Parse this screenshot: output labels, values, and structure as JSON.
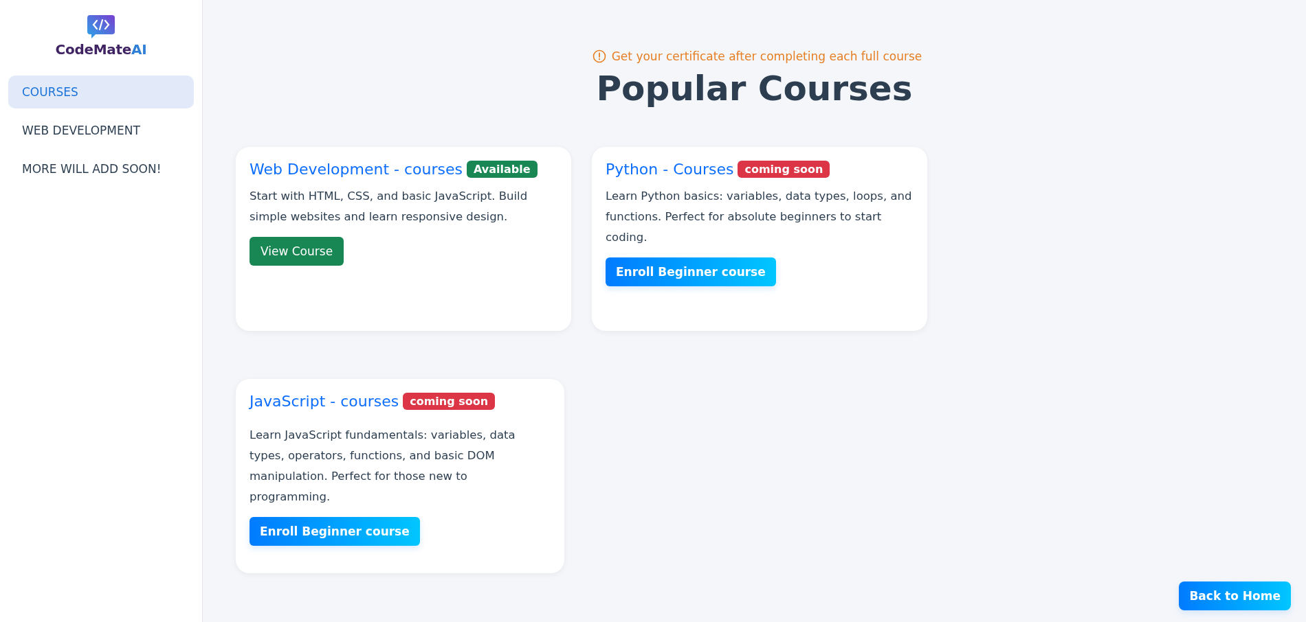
{
  "brand": {
    "name": "CodeMate",
    "accent": "AI"
  },
  "sidebar": {
    "items": [
      {
        "label": "COURSES",
        "selected": true
      },
      {
        "label": "WEB DEVELOPMENT",
        "selected": false
      },
      {
        "label": "MORE WILL ADD SOON!",
        "selected": false
      }
    ]
  },
  "notice": "Get your certificate after completing each full course",
  "title": "Popular Courses",
  "courses": [
    {
      "title": "Web Development - courses",
      "badge": {
        "text": "Available",
        "kind": "available"
      },
      "description": "Start with HTML, CSS, and basic JavaScript. Build simple websites and learn responsive design.",
      "button": {
        "label": "View Course",
        "kind": "view"
      }
    },
    {
      "title": "Python - Courses",
      "badge": {
        "text": "coming soon",
        "kind": "soon"
      },
      "description": "Learn Python basics: variables, data types, loops, and functions. Perfect for absolute beginners to start coding.",
      "button": {
        "label": "Enroll Beginner course",
        "kind": "enroll"
      }
    },
    {
      "title": "JavaScript - courses",
      "badge": {
        "text": "coming soon",
        "kind": "soon"
      },
      "description": "Learn JavaScript fundamentals: variables, data types, operators, functions, and basic DOM manipulation. Perfect for those new to programming.",
      "button": {
        "label": "Enroll Beginner course",
        "kind": "enroll"
      }
    }
  ],
  "back_button": "Back to Home"
}
